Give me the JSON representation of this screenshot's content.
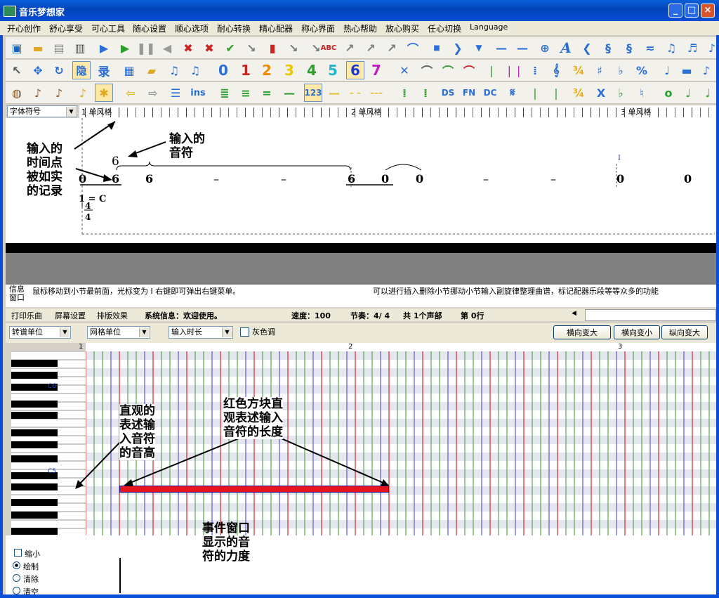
{
  "window": {
    "title": "音乐梦想家",
    "minimize": "_",
    "maximize": "□",
    "close": "×"
  },
  "menu": [
    "开心创作",
    "舒心享受",
    "可心工具",
    "随心设置",
    "顺心选项",
    "耐心转换",
    "精心配器",
    "称心界面",
    "热心帮助",
    "放心购买",
    "任心切换",
    "Language"
  ],
  "score": {
    "font_combo": "字体符号",
    "measure_labels": [
      "1 单风格",
      "2 单风格",
      "3 单风格"
    ],
    "notes_row": [
      "0",
      "6",
      "6",
      "–",
      "–",
      "6",
      "0",
      "0",
      "–",
      "–",
      "0",
      "0"
    ],
    "tuplet_number": "6",
    "key": "1 = C",
    "time_num": "4",
    "time_den": "4",
    "cursor_char": "I",
    "annotation_time": "输入的\n时间点\n被如实\n的记录",
    "annotation_note": "输入的\n音符"
  },
  "info": {
    "label": "信息\n窗口",
    "left_text": "鼠标移动到小节最前面，光标变为 I 右键即可弹出右键菜单。",
    "right_text": "可以进行插入删除小节挪动小节输入副旋律整理曲谱，标记配器乐段等等众多的功能"
  },
  "status": {
    "tabs": [
      "打印乐曲",
      "屏幕设置",
      "排版效果"
    ],
    "system": "系统信息：欢迎使用。",
    "speed": "速度：100",
    "meter": "节奏：4/ 4",
    "voices": "共 1个声部",
    "row": "第 0行"
  },
  "pianoroll": {
    "combo1": "转谱单位",
    "combo2": "网格单位",
    "combo3": "输入时长",
    "gray_label": "灰色调",
    "btn_hzoom_in": "横向变大",
    "btn_hzoom_out": "横向变小",
    "btn_vzoom_in": "纵向变大",
    "ruler": [
      "1",
      "2",
      "3"
    ],
    "c6": "C6",
    "c5": "C5",
    "annotation_pitch": "直观的\n表述输\n入音符\n的音高",
    "annotation_length": "红色方块直\n观表述输入\n音符的长度",
    "annotation_velocity": "事件窗口\n显示的音\n符的力度",
    "options": [
      "缩小",
      "绘制",
      "清除",
      "清空"
    ]
  },
  "colors": {
    "note_red": "#e8141c",
    "note_border": "#1a1aa0",
    "grid_red": "#d40000",
    "grid_green": "#2e9e2e",
    "grid_blue": "#3a3ad4"
  }
}
